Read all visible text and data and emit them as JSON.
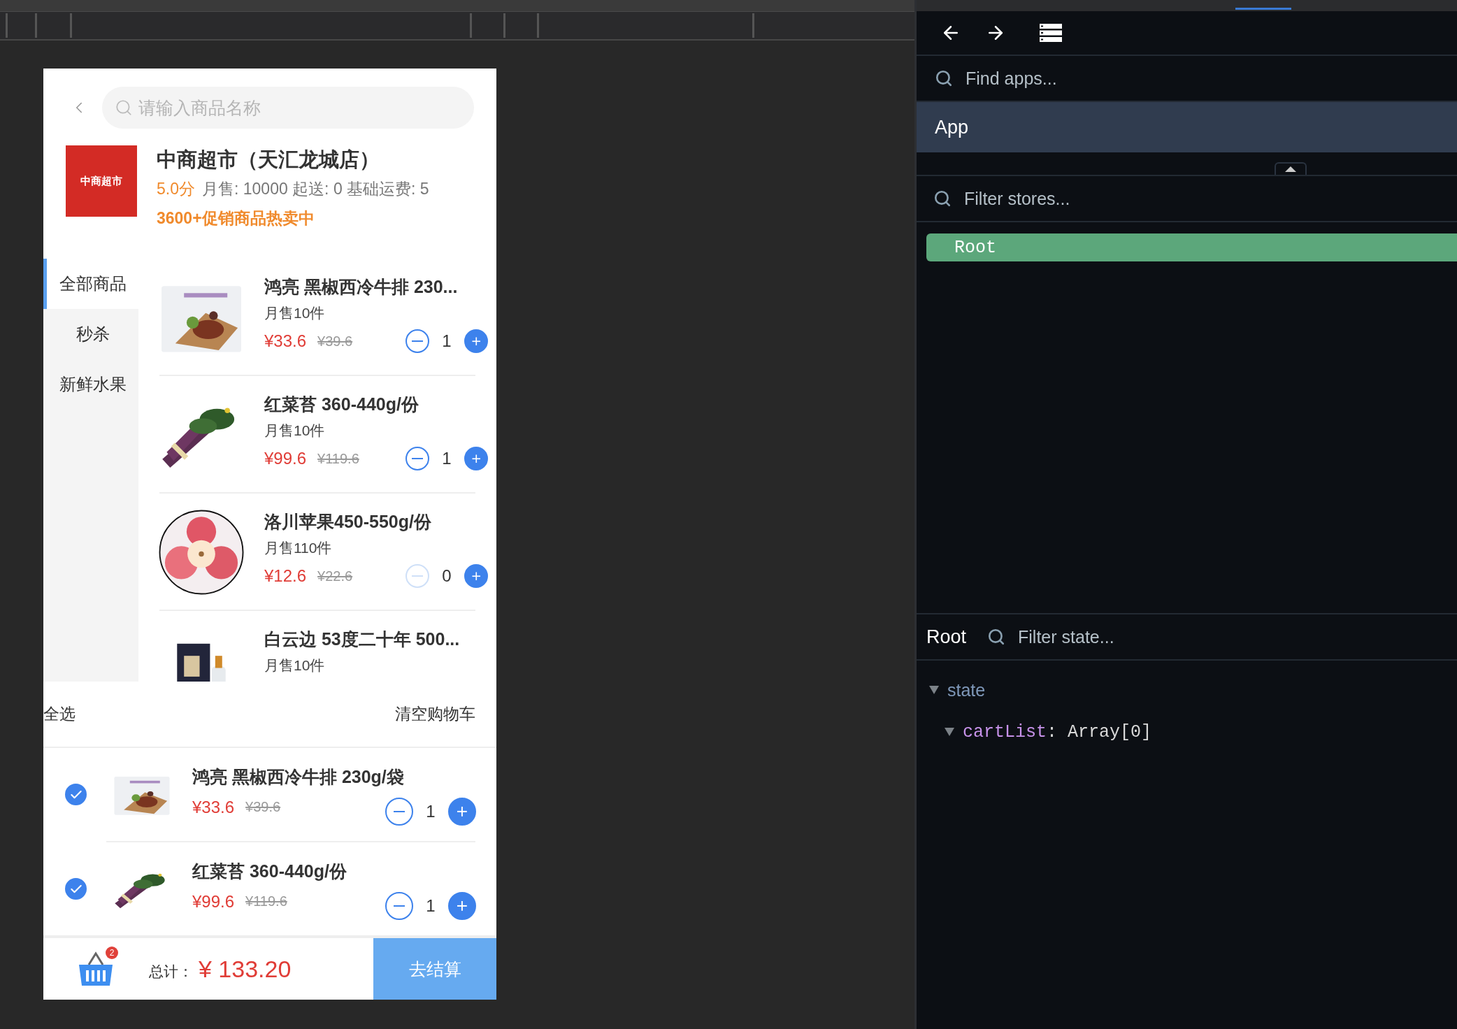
{
  "search": {
    "placeholder": "请输入商品名称"
  },
  "shop": {
    "logo_text": "中商超市",
    "name": "中商超市（天汇龙城店）",
    "rating": "5.0分",
    "stats": "月售: 10000 起送: 0 基础运费: 5",
    "promo": "3600+促销商品热卖中"
  },
  "categories": [
    {
      "label": "全部商品",
      "selected": true
    },
    {
      "label": "秒杀",
      "selected": false
    },
    {
      "label": "新鲜水果",
      "selected": false
    }
  ],
  "products": [
    {
      "title": "鸿亮 黑椒西冷牛排 230...",
      "sales": "月售10件",
      "price": "¥33.6",
      "original_price": "¥39.6",
      "quantity": "1",
      "minus_disabled": false
    },
    {
      "title": "红菜苔 360-440g/份",
      "sales": "月售10件",
      "price": "¥99.6",
      "original_price": "¥119.6",
      "quantity": "1",
      "minus_disabled": false
    },
    {
      "title": "洛川苹果450-550g/份",
      "sales": "月售110件",
      "price": "¥12.6",
      "original_price": "¥22.6",
      "quantity": "0",
      "minus_disabled": true
    },
    {
      "title": "白云边 53度二十年 500...",
      "sales": "月售10件"
    }
  ],
  "cart": {
    "select_all": "全选",
    "clear": "清空购物车",
    "items": [
      {
        "checked": true,
        "title": "鸿亮 黑椒西冷牛排 230g/袋",
        "price": "¥33.6",
        "original_price": "¥39.6",
        "quantity": "1"
      },
      {
        "checked": true,
        "title": "红菜苔 360-440g/份",
        "price": "¥99.6",
        "original_price": "¥119.6",
        "quantity": "1"
      }
    ]
  },
  "footer": {
    "badge": "2",
    "total_label": "总计：",
    "total": "¥ 133.20",
    "checkout": "去结算"
  },
  "devtools": {
    "find_apps": {
      "placeholder": "Find apps..."
    },
    "apps": [
      {
        "label": "App",
        "selected": true
      }
    ],
    "filter_stores": {
      "placeholder": "Filter stores..."
    },
    "stores": [
      {
        "label": "Root",
        "selected": true
      }
    ],
    "state_panel": {
      "store": "Root",
      "filter": {
        "placeholder": "Filter state..."
      },
      "tree": [
        {
          "key": "state",
          "expanded": true,
          "children": [
            {
              "key": "cartList",
              "value": ": Array[0]",
              "expanded": true
            }
          ]
        }
      ]
    }
  }
}
